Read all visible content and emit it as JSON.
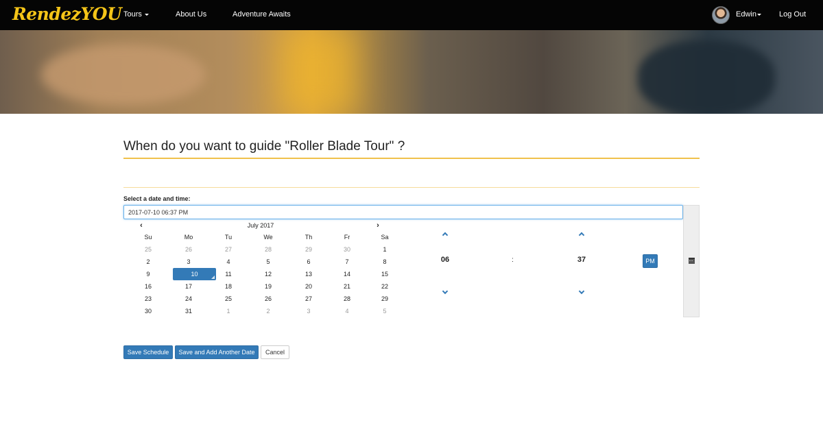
{
  "navbar": {
    "brand": "RendezYOU",
    "items": [
      {
        "label": "Tours",
        "dropdown": true
      },
      {
        "label": "About Us"
      },
      {
        "label": "Adventure Awaits"
      }
    ],
    "user": {
      "name": "Edwin",
      "avatar": "user-avatar"
    },
    "logout_label": "Log Out"
  },
  "page": {
    "title": "When do you want to guide \"Roller Blade Tour\" ?"
  },
  "form": {
    "label": "Select a date and time:",
    "datetime_value": "2017-07-10 06:37 PM"
  },
  "calendar": {
    "month_label": "July 2017",
    "prev_icon": "chevron-left-icon",
    "next_icon": "chevron-right-icon",
    "weekdays": [
      "Su",
      "Mo",
      "Tu",
      "We",
      "Th",
      "Fr",
      "Sa"
    ],
    "weeks": [
      [
        "25",
        "26",
        "27",
        "28",
        "29",
        "30",
        "1"
      ],
      [
        "2",
        "3",
        "4",
        "5",
        "6",
        "7",
        "8"
      ],
      [
        "9",
        "10",
        "11",
        "12",
        "13",
        "14",
        "15"
      ],
      [
        "16",
        "17",
        "18",
        "19",
        "20",
        "21",
        "22"
      ],
      [
        "23",
        "24",
        "25",
        "26",
        "27",
        "28",
        "29"
      ],
      [
        "30",
        "31",
        "1",
        "2",
        "3",
        "4",
        "5"
      ]
    ],
    "selected_day": "10"
  },
  "time": {
    "hour": "06",
    "separator": ":",
    "minute": "37",
    "period": "PM"
  },
  "buttons": {
    "save": "Save Schedule",
    "save_add": "Save and Add Another Date",
    "cancel": "Cancel"
  },
  "colors": {
    "accent": "#f0c14b",
    "primary": "#337ab7",
    "navbar": "#050505",
    "brand": "#f5c518"
  }
}
